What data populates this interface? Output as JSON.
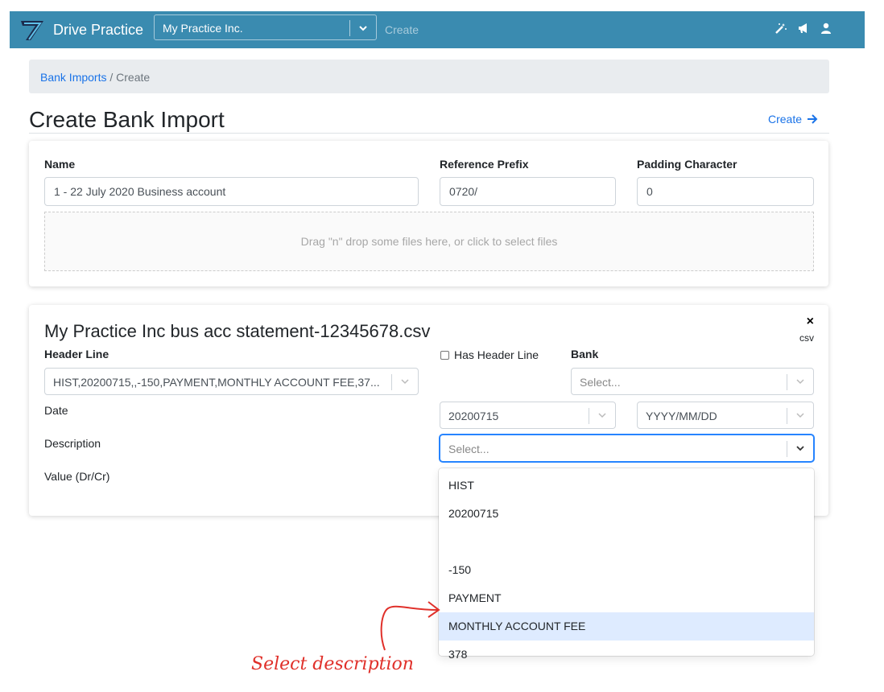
{
  "nav": {
    "brand": "Drive Practice",
    "org_value": "My Practice Inc.",
    "create_label": "Create",
    "icons": [
      "magic-wand-icon",
      "megaphone-icon",
      "user-icon"
    ]
  },
  "breadcrumb": {
    "link": "Bank Imports",
    "separator": "/",
    "current": "Create"
  },
  "page": {
    "title": "Create Bank Import",
    "create_action": "Create"
  },
  "import_form": {
    "name_label": "Name",
    "name_value": "1 - 22 July 2020 Business account",
    "prefix_label": "Reference Prefix",
    "prefix_value": "0720/",
    "padding_label": "Padding Character",
    "padding_value": "0",
    "dropzone_text": "Drag \"n\" drop some files here, or click to select files"
  },
  "file_card": {
    "file_name": "My Practice Inc bus acc statement-12345678.csv",
    "close_symbol": "×",
    "file_type": "csv",
    "header_line_label": "Header Line",
    "header_line_value": "HIST,20200715,,-150,PAYMENT,MONTHLY ACCOUNT FEE,37...",
    "has_header_label": "Has Header Line",
    "bank_label": "Bank",
    "bank_placeholder": "Select...",
    "date_label": "Date",
    "date_value": "20200715",
    "date_format_value": "YYYY/MM/DD",
    "description_label": "Description",
    "description_placeholder": "Select...",
    "value_label": "Value (Dr/Cr)"
  },
  "description_menu": {
    "options": [
      "HIST",
      "20200715",
      "",
      "-150",
      "PAYMENT",
      "MONTHLY ACCOUNT FEE",
      "378"
    ],
    "highlighted": "MONTHLY ACCOUNT FEE"
  },
  "annotation": {
    "text": "Select description",
    "color": "#e0302a"
  },
  "colors": {
    "nav_bg": "#3a8bb0",
    "link": "#1a73e8",
    "focus": "#2684ff",
    "option_highlight": "#deebff"
  }
}
